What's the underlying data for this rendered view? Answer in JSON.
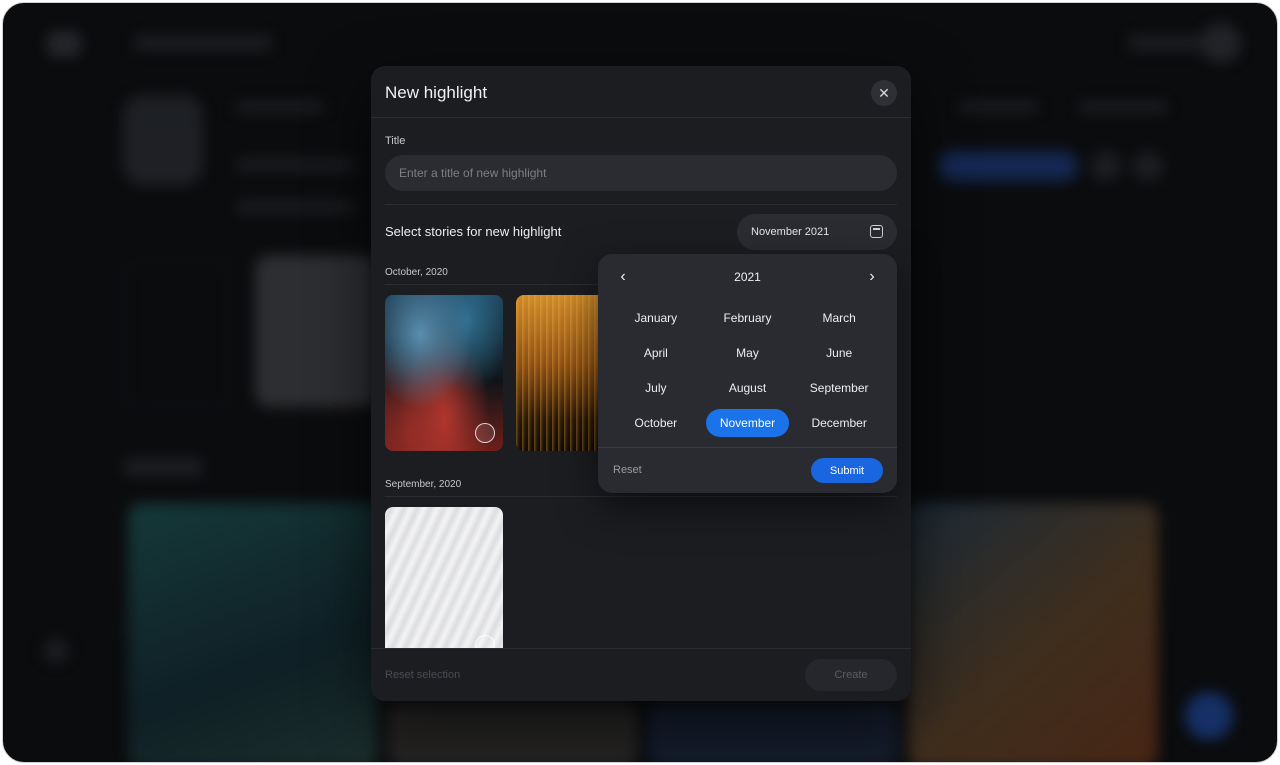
{
  "modal": {
    "title": "New highlight",
    "close_icon": "close-icon",
    "title_field": {
      "label": "Title",
      "value": "",
      "placeholder": "Enter a title of new highlight"
    },
    "section_title": "Select stories for new highlight",
    "date_button": {
      "label": "November 2021",
      "icon": "calendar-icon"
    },
    "groups": [
      {
        "label": "October, 2020",
        "stories": [
          "ink-blue-red",
          "gold-streaks"
        ]
      },
      {
        "label": "September, 2020",
        "stories": [
          "white-feather"
        ]
      }
    ],
    "footer": {
      "reset_selection_label": "Reset selection",
      "create_label": "Create"
    }
  },
  "picker": {
    "year": "2021",
    "prev_icon": "chevron-left-icon",
    "next_icon": "chevron-right-icon",
    "months": [
      "January",
      "February",
      "March",
      "April",
      "May",
      "June",
      "July",
      "August",
      "September",
      "October",
      "November",
      "December"
    ],
    "selected_month": "November",
    "reset_label": "Reset",
    "submit_label": "Submit"
  },
  "colors": {
    "accent": "#1a73e8",
    "modal_bg": "#1c1d21",
    "popover_bg": "#2a2b30"
  }
}
